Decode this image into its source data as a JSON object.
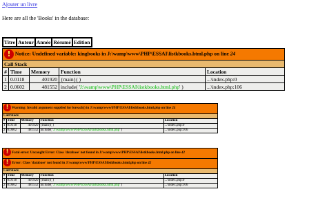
{
  "link": {
    "add_book": "Ajouter un livre"
  },
  "intro_text": "Here are all the 'Books' in the database:",
  "books_table": {
    "headers": [
      "Titre",
      "Auteur",
      "Année",
      "Résumé",
      "Edition"
    ]
  },
  "errors": [
    {
      "message": "Notice: Undefined variable: kingbooks in J:\\wamp\\www\\PHP\\ESSAI\\listkbooks.html.php on line ",
      "line": "24",
      "call_stack_label": "Call Stack",
      "columns": [
        "#",
        "Time",
        "Memory",
        "Function",
        "Location"
      ],
      "rows": [
        {
          "n": "1",
          "time": "0.0118",
          "memory": "401920",
          "func": "{main}( )",
          "func_arg": "",
          "func_end": "",
          "location": "...\\index.php:0"
        },
        {
          "n": "2",
          "time": "0.0602",
          "memory": "481552",
          "func": "include( '",
          "func_arg": "J:\\wamp\\www\\PHP\\ESSAI\\listkbooks.html.php",
          "func_end": "' )",
          "location": "...\\index.php:106"
        }
      ]
    },
    {
      "message": "Warning: Invalid argument supplied for foreach() in J:\\wamp\\www\\PHP\\ESSAI\\listkbooks.html.php on line ",
      "line": "24",
      "call_stack_label": "Call Stack",
      "columns": [
        "#",
        "Time",
        "Memory",
        "Function",
        "Location"
      ],
      "rows": [
        {
          "n": "1",
          "time": "0.0118",
          "memory": "401920",
          "func": "{main}( )",
          "func_arg": "",
          "func_end": "",
          "location": "...\\index.php:0"
        },
        {
          "n": "2",
          "time": "0.0602",
          "memory": "481552",
          "func": "include( '",
          "func_arg": "J:\\wamp\\www\\PHP\\ESSAI\\listkbooks.html.php",
          "func_end": "' )",
          "location": "...\\index.php:106"
        }
      ]
    },
    {
      "message": "Fatal error: Uncaught Error: Class 'database' not found in J:\\wamp\\www\\PHP\\ESSAI\\listkbooks.html.php on line ",
      "line": "42",
      "message2": "Error: Class 'database' not found in J:\\wamp\\www\\PHP\\ESSAI\\listkbooks.html.php on line ",
      "line2": "42",
      "call_stack_label": "Call Stack",
      "columns": [
        "#",
        "Time",
        "Memory",
        "Function",
        "Location"
      ],
      "rows": [
        {
          "n": "1",
          "time": "0.0118",
          "memory": "401920",
          "func": "{main}( )",
          "func_arg": "",
          "func_end": "",
          "location": "...\\index.php:0"
        },
        {
          "n": "2",
          "time": "0.0602",
          "memory": "481552",
          "func": "include( '",
          "func_arg": "J:\\wamp\\www\\PHP\\ESSAI\\listkbooks.html.php",
          "func_end": "' )",
          "location": "...\\index.php:106"
        }
      ]
    }
  ],
  "colors": {
    "message_bg": "#f57900",
    "callstack_bg": "#e9b96e",
    "header_bg": "#eeeeec",
    "icon_bg": "#cc0000",
    "icon_fg": "#fce94f",
    "path_green": "#00bb00",
    "link_blue": "#2a2adf"
  },
  "icons": {
    "error": "exclamation-icon"
  }
}
